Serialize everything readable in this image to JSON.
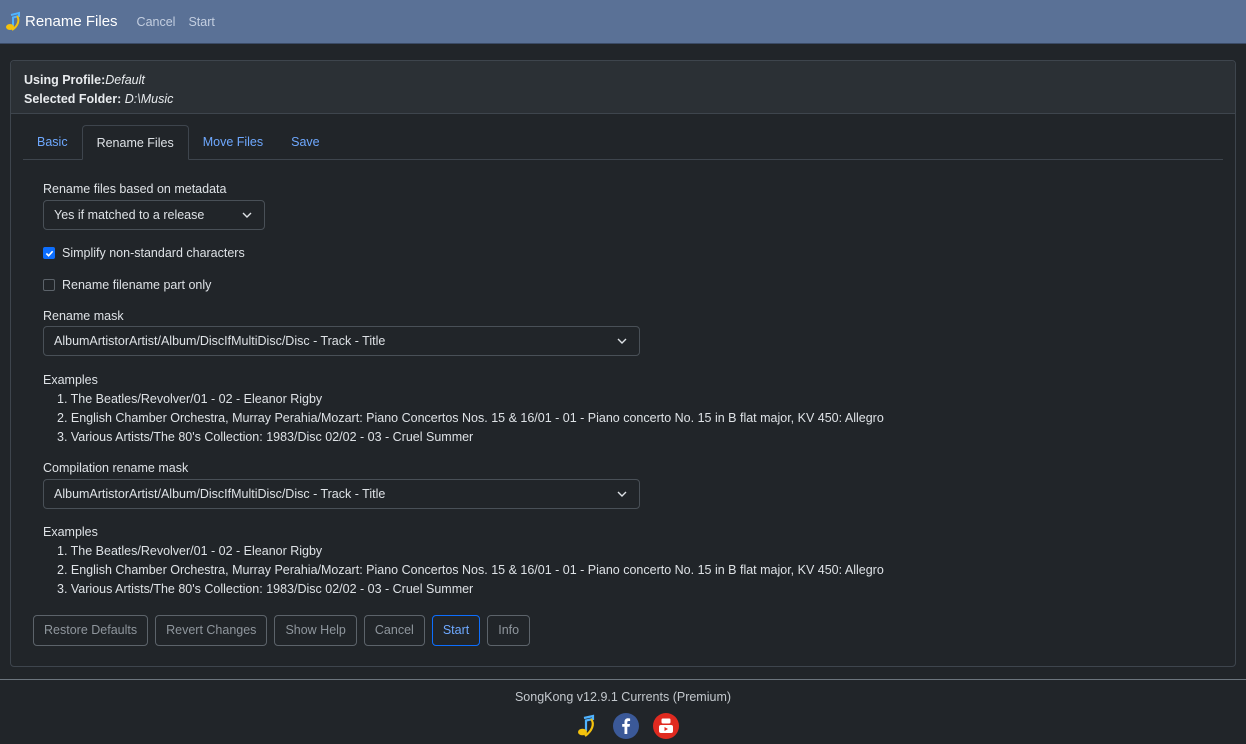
{
  "navbar": {
    "title": "Rename Files",
    "links": [
      "Cancel",
      "Start"
    ],
    "logo_icon": "songkong-music-note-icon"
  },
  "header": {
    "profile_label": "Using Profile:",
    "profile_value": "Default",
    "folder_label": "Selected Folder:",
    "folder_value": "D:\\Music"
  },
  "tabs": [
    "Basic",
    "Rename Files",
    "Move Files",
    "Save"
  ],
  "active_tab": "Rename Files",
  "rename_based": {
    "label": "Rename files based on metadata",
    "value": "Yes if matched to a release"
  },
  "checkboxes": [
    {
      "label": "Simplify non-standard characters",
      "checked": true
    },
    {
      "label": "Rename filename part only",
      "checked": false
    }
  ],
  "rename_mask": {
    "label": "Rename mask",
    "value": "AlbumArtistorArtist/Album/DiscIfMultiDisc/Disc - Track - Title"
  },
  "examples1": {
    "title": "Examples",
    "items": [
      "1. The Beatles/Revolver/01 - 02 - Eleanor Rigby",
      "2. English Chamber Orchestra, Murray Perahia/Mozart: Piano Concertos Nos. 15 & 16/01 - 01 - Piano concerto No. 15 in B flat major, KV 450: Allegro",
      "3. Various Artists/The 80's Collection: 1983/Disc 02/02 - 03 - Cruel Summer"
    ]
  },
  "compilation_mask": {
    "label": "Compilation rename mask",
    "value": "AlbumArtistorArtist/Album/DiscIfMultiDisc/Disc - Track - Title"
  },
  "examples2": {
    "title": "Examples",
    "items": [
      "1. The Beatles/Revolver/01 - 02 - Eleanor Rigby",
      "2. English Chamber Orchestra, Murray Perahia/Mozart: Piano Concertos Nos. 15 & 16/01 - 01 - Piano concerto No. 15 in B flat major, KV 450: Allegro",
      "3. Various Artists/The 80's Collection: 1983/Disc 02/02 - 03 - Cruel Summer"
    ]
  },
  "buttons": [
    "Restore Defaults",
    "Revert Changes",
    "Show Help",
    "Cancel",
    "Start",
    "Info"
  ],
  "footer": {
    "version": "SongKong v12.9.1 Currents (Premium)",
    "icons": [
      "songkong-icon",
      "facebook-icon",
      "youtube-icon"
    ]
  },
  "colors": {
    "navbar": "#5a7196",
    "accent": "#0d6efd",
    "link": "#6ea8fe",
    "background": "#212529"
  }
}
